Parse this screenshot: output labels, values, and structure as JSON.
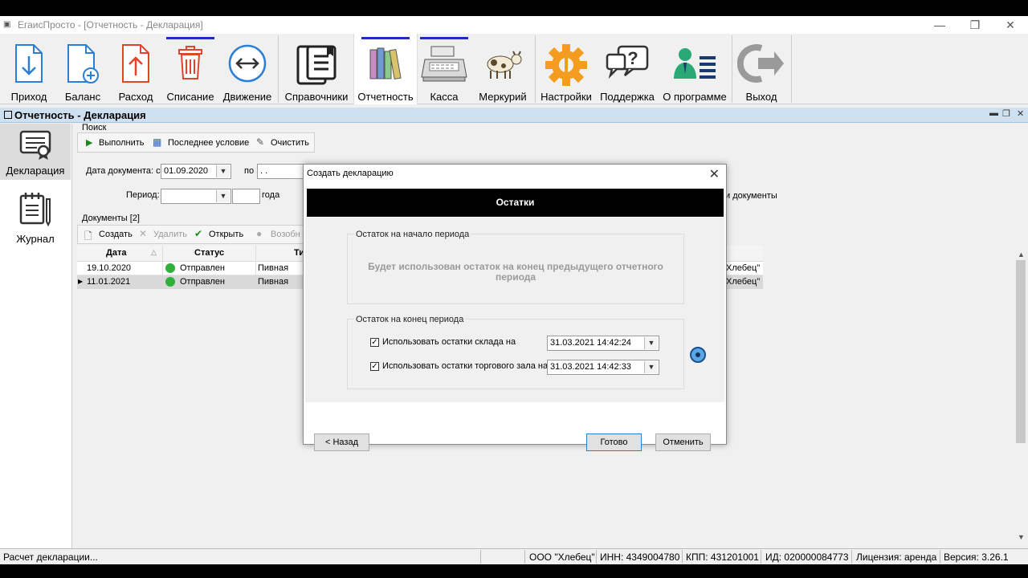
{
  "window": {
    "title": "ЕгаисПросто - [Отчетность - Декларация]"
  },
  "toolbar": {
    "items": [
      {
        "label": "Приход",
        "icon": "arrow-down-doc-icon"
      },
      {
        "label": "Баланс",
        "icon": "doc-plus-icon"
      },
      {
        "label": "Расход",
        "icon": "arrow-up-doc-icon"
      },
      {
        "label": "Списание",
        "icon": "trash-icon"
      },
      {
        "label": "Движение",
        "icon": "left-right-arrows-icon"
      },
      {
        "label": "Справочники",
        "icon": "binders-icon"
      },
      {
        "label": "Отчетность",
        "icon": "books-icon"
      },
      {
        "label": "Касса",
        "icon": "cash-register-icon"
      },
      {
        "label": "Меркурий",
        "icon": "cow-icon"
      },
      {
        "label": "Настройки",
        "icon": "gear-icon"
      },
      {
        "label": "Поддержка",
        "icon": "help-bubble-icon"
      },
      {
        "label": "О программе",
        "icon": "info-person-icon"
      },
      {
        "label": "Выход",
        "icon": "exit-arrow-icon"
      }
    ]
  },
  "section": {
    "title": "Отчетность - Декларация"
  },
  "leftnav": {
    "items": [
      {
        "label": "Декларация"
      },
      {
        "label": "Журнал"
      }
    ]
  },
  "search": {
    "group_label": "Поиск",
    "execute": "Выполнить",
    "last_condition": "Последнее условие",
    "clear": "Очистить",
    "date_from_label": "Дата документа: с",
    "date_from_value": "01.09.2020",
    "date_to_label": "по",
    "date_to_value": ". .",
    "period_label": "Период:",
    "year_label": "года",
    "right_text": "и документы"
  },
  "documents": {
    "group_label": "Документы [2]",
    "create": "Создать",
    "delete": "Удалить",
    "open": "Открыть",
    "resume": "Возобн",
    "columns": [
      "Дата",
      "Статус",
      "Ти"
    ],
    "rows": [
      {
        "date": "19.10.2020",
        "status": "Отправлен",
        "type": "Пивная",
        "org": "Хлебец\""
      },
      {
        "date": "11.01.2021",
        "status": "Отправлен",
        "type": "Пивная",
        "org": "Хлебец\""
      }
    ]
  },
  "dialog": {
    "caption": "Создать декларацию",
    "heading": "Остатки",
    "start_group": "Остаток на начало периода",
    "start_text": "Будет использован остаток на конец предыдущего отчетного периода",
    "end_group": "Остаток на конец периода",
    "warehouse_label": "Использовать остатки склада на",
    "warehouse_value": "31.03.2021 14:42:24",
    "hall_label": "Использовать остатки торгового зала на",
    "hall_value": "31.03.2021 14:42:33",
    "back": "< Назад",
    "done": "Готово",
    "cancel": "Отменить"
  },
  "status": {
    "message": "Расчет декларации...",
    "org": "ООО \"Хлебец\"",
    "inn": "ИНН: 4349004780",
    "kpp": "КПП: 431201001",
    "id": "ИД: 020000084773",
    "license": "Лицензия: аренда",
    "version": "Версия: 3.26.1"
  }
}
